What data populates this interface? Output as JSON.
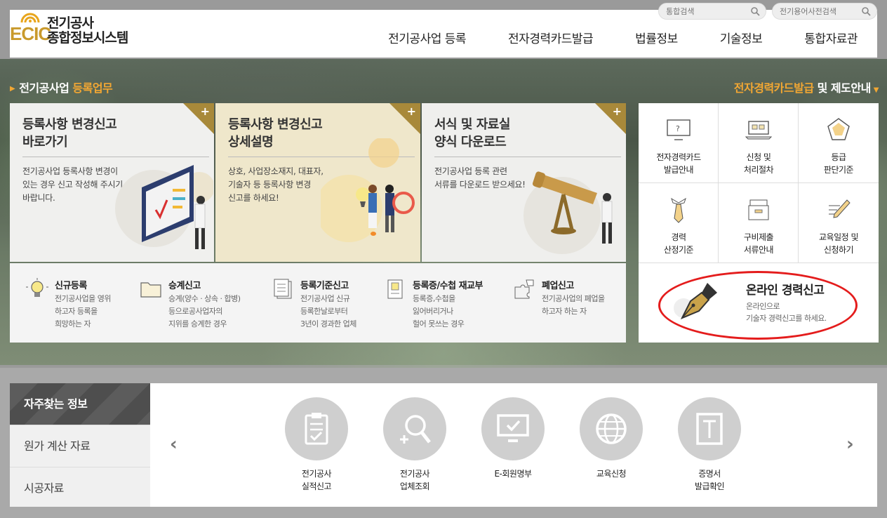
{
  "header": {
    "logo_mark": "ECIC",
    "logo_line1": "전기공사",
    "logo_line2": "종합정보시스템",
    "nav": [
      "전기공사업 등록",
      "전자경력카드발급",
      "법률정보",
      "기술정보",
      "통합자료관"
    ],
    "search1_placeholder": "통합검색",
    "search2_placeholder": "전기용어사전검색"
  },
  "section_left": {
    "prefix": "전기공사업 ",
    "accent": "등록업무"
  },
  "section_right": {
    "accent": "전자경력카드발급",
    "suffix": " 및 제도안내"
  },
  "cards": [
    {
      "title1": "등록사항 변경신고",
      "title2": "바로가기",
      "desc1": "전기공사업 등록사항 변경이",
      "desc2": "있는 경우 신고 작성해 주시기",
      "desc3": "바랍니다.",
      "plus": "+"
    },
    {
      "title1": "등록사항 변경신고",
      "title2": "상세설명",
      "desc1": "상호, 사업장소재지, 대표자,",
      "desc2": "기술자 등 등록사항 변경",
      "desc3": "신고를 하세요!",
      "plus": "+"
    },
    {
      "title1": "서식 및 자료실",
      "title2": "양식 다운로드",
      "desc1": "전기공사업 등록 관련",
      "desc2": "서류를 다운로드 받으세요!",
      "desc3": "",
      "plus": "+"
    }
  ],
  "strip_items": [
    {
      "title": "신규등록",
      "desc1": "전기공사업을 영위",
      "desc2": "하고자 등록을",
      "desc3": "희망하는 자"
    },
    {
      "title": "승계신고",
      "desc1": "승계(양수 · 상속 · 합병)",
      "desc2": "등으로공사업자의",
      "desc3": "지위를 승계한 경우"
    },
    {
      "title": "등록기준신고",
      "desc1": "전기공사업 신규",
      "desc2": "등록한날로부터",
      "desc3": "3년이 경과한 업체"
    },
    {
      "title": "등록증/수첩 재교부",
      "desc1": "등록증,수첩을",
      "desc2": "잃어버리거나",
      "desc3": "헐어 못쓰는 경우"
    },
    {
      "title": "폐업신고",
      "desc1": "전기공사업의 폐업을",
      "desc2": "하고자 하는 자",
      "desc3": ""
    }
  ],
  "right_grid": [
    {
      "line1": "전자경력카드",
      "line2": "발급안내"
    },
    {
      "line1": "신청 및",
      "line2": "처리절차"
    },
    {
      "line1": "등급",
      "line2": "판단기준"
    },
    {
      "line1": "경력",
      "line2": "산정기준"
    },
    {
      "line1": "구비제출",
      "line2": "서류안내"
    },
    {
      "line1": "교육일정 및",
      "line2": "신청하기"
    }
  ],
  "online": {
    "title": "온라인 경력신고",
    "desc1": "온라인으로",
    "desc2": "기술자 경력신고를 하세요."
  },
  "tabs": [
    "자주찾는 정보",
    "원가 계산 자료",
    "시공자료"
  ],
  "quick": [
    {
      "line1": "전기공사",
      "line2": "실적신고"
    },
    {
      "line1": "전기공사",
      "line2": "업체조회"
    },
    {
      "line1": "E-회원명부",
      "line2": ""
    },
    {
      "line1": "교육신청",
      "line2": ""
    },
    {
      "line1": "증명서",
      "line2": "발급확인"
    }
  ],
  "arrows": {
    "prev": "‹",
    "next": "›"
  },
  "colors": {
    "accent": "#f2a733",
    "gold": "#a8893a",
    "highlight_oval": "#e41c1c"
  }
}
